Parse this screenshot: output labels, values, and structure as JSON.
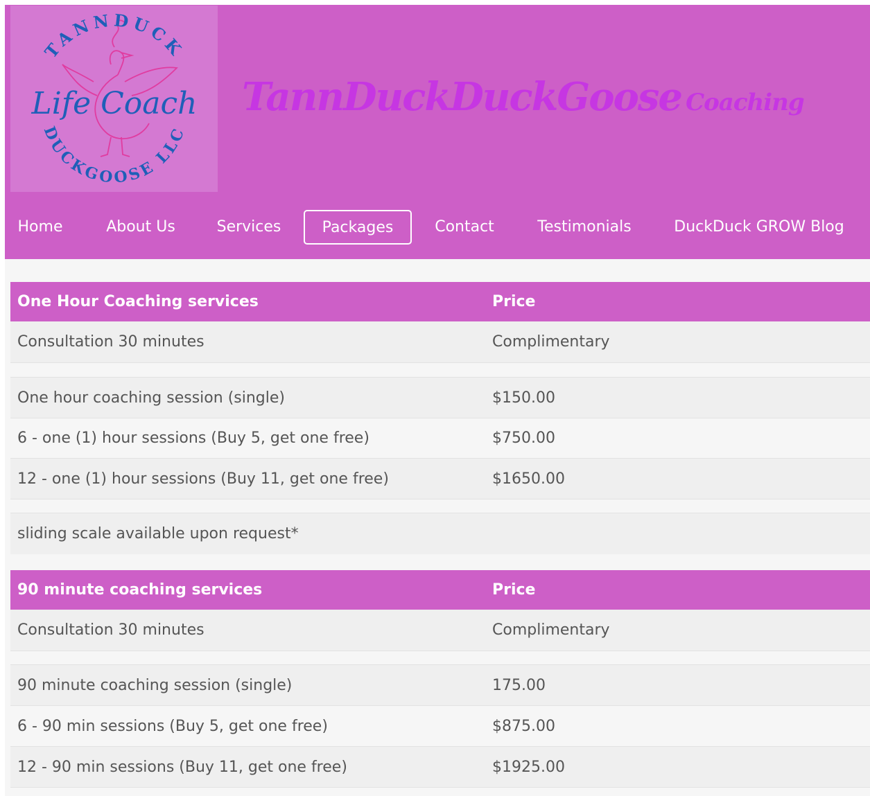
{
  "brand": {
    "logo_ring_top": "TANNDUCK",
    "logo_center": "Life Coach",
    "logo_ring_bottom": "DUCKGOOSE LLC",
    "title_main": "TannDuckDuckGoose",
    "title_sub": "Coaching"
  },
  "nav": {
    "items": [
      {
        "label": "Home"
      },
      {
        "label": "About Us"
      },
      {
        "label": "Services"
      },
      {
        "label": "Packages",
        "active": true
      },
      {
        "label": "Contact"
      },
      {
        "label": "Testimonials"
      },
      {
        "label": "DuckDuck GROW Blog"
      }
    ]
  },
  "tables": [
    {
      "header": {
        "service": "One Hour Coaching services",
        "price": "Price"
      },
      "rows": [
        {
          "service": "Consultation 30 minutes",
          "price": "Complimentary"
        },
        {
          "service": "",
          "price": ""
        },
        {
          "service": "One hour coaching session (single)",
          "price": "$150.00"
        },
        {
          "service": "6 - one (1) hour sessions (Buy 5, get one free)",
          "price": "$750.00"
        },
        {
          "service": "12 - one (1) hour sessions (Buy 11, get one free)",
          "price": "$1650.00"
        },
        {
          "service": "",
          "price": ""
        },
        {
          "service": "sliding scale available upon request*",
          "price": ""
        }
      ]
    },
    {
      "header": {
        "service": "90 minute coaching services",
        "price": "Price"
      },
      "rows": [
        {
          "service": "Consultation 30 minutes",
          "price": "Complimentary"
        },
        {
          "service": "",
          "price": ""
        },
        {
          "service": "90 minute coaching session (single)",
          "price": "175.00"
        },
        {
          "service": "6 - 90 min sessions (Buy 5, get one free)",
          "price": "$875.00"
        },
        {
          "service": "12 - 90 min sessions (Buy 11, get one free)",
          "price": "$1925.00"
        }
      ]
    }
  ],
  "colors": {
    "header_bg": "#cd5fc7",
    "logo_bg": "#d479d2",
    "title": "#c636e2",
    "logo_text": "#1f5fb8",
    "row_bg": "#efefef"
  }
}
